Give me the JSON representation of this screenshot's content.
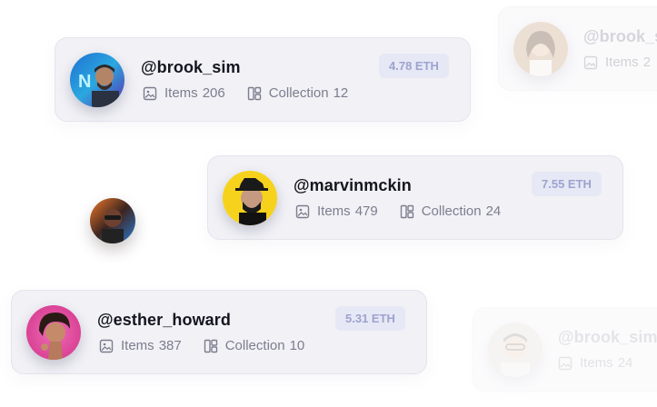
{
  "cards": [
    {
      "handle": "@brook_sim",
      "items_label": "Items",
      "items_count": "206",
      "collection_label": "Collection",
      "collection_count": "12",
      "price": "4.78 ETH"
    },
    {
      "handle": "@marvinmckin",
      "items_label": "Items",
      "items_count": "479",
      "collection_label": "Collection",
      "collection_count": "24",
      "price": "7.55 ETH"
    },
    {
      "handle": "@esther_howard",
      "items_label": "Items",
      "items_count": "387",
      "collection_label": "Collection",
      "collection_count": "10",
      "price": "5.31 ETH"
    }
  ],
  "faded_cards": [
    {
      "handle": "@brook_sim",
      "items_label": "Items",
      "items_count": "2"
    },
    {
      "handle": "@brook_sim",
      "items_label": "Items",
      "items_count": "24"
    }
  ],
  "colors": {
    "card_bg": "#f1f1f6",
    "price_bg": "#e6e8f5",
    "price_text": "#9ea3cf",
    "accent_yellow": "#f7d21c",
    "accent_pink": "#e84aa0"
  },
  "icons": {
    "items": "image-icon",
    "collection": "collection-icon"
  }
}
